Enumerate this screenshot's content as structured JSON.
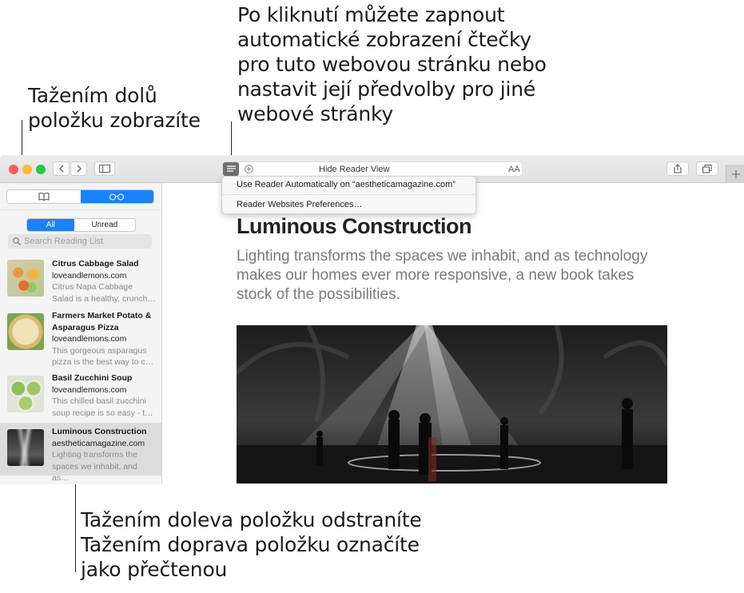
{
  "callouts": {
    "reader_menu": "Po kliknutí můžete zapnout\nautomatické zobrazení čtečky\npro tuto webovou stránku nebo\nnastavit její předvolby pro jiné\nwebové stránky",
    "pull_down": "Tažením dolů\npoložku zobrazíte",
    "swipe": "Tažením doleva položku odstraníte\nTažením doprava položku označíte\njako přečtenou"
  },
  "toolbar": {
    "address_title": "Hide Reader View",
    "text_size_label": "AA"
  },
  "reader_menu": {
    "items": [
      "Use Reader Automatically on “aestheticamagazine.com”",
      "Reader Websites Preferences…"
    ]
  },
  "sidebar": {
    "filter": {
      "all": "All",
      "unread": "Unread",
      "selected": "All"
    },
    "search_placeholder": "Search Reading List",
    "items": [
      {
        "title": "Citrus Cabbage Salad",
        "site": "loveandlemons.com",
        "desc1": "Citrus Napa Cabbage",
        "desc2": "Salad is a healthy, crunch…"
      },
      {
        "title": "Farmers Market Potato &",
        "title2": "Asparagus Pizza",
        "site": "loveandlemons.com",
        "desc1": "This gorgeous asparagus",
        "desc2": "pizza is the best way to c…"
      },
      {
        "title": "Basil Zucchini Soup",
        "site": "loveandlemons.com",
        "desc1": "This chilled basil zucchini",
        "desc2": "soup recipe is so easy - t…"
      },
      {
        "title": "Luminous Construction",
        "site": "aestheticamagazine.com",
        "desc1": "Lighting transforms the",
        "desc2": "spaces we inhabit, and as…"
      }
    ]
  },
  "article": {
    "title": "Luminous Construction",
    "dek": "Lighting transforms the spaces we inhabit, and as technology makes our homes ever more responsive, a new book takes stock of the possibilities."
  },
  "colors": {
    "accent": "#1a82fb",
    "close": "#fc5f57",
    "minimize": "#fdbc2e",
    "zoom": "#28c840",
    "selected_row": "#dcdcdc"
  }
}
